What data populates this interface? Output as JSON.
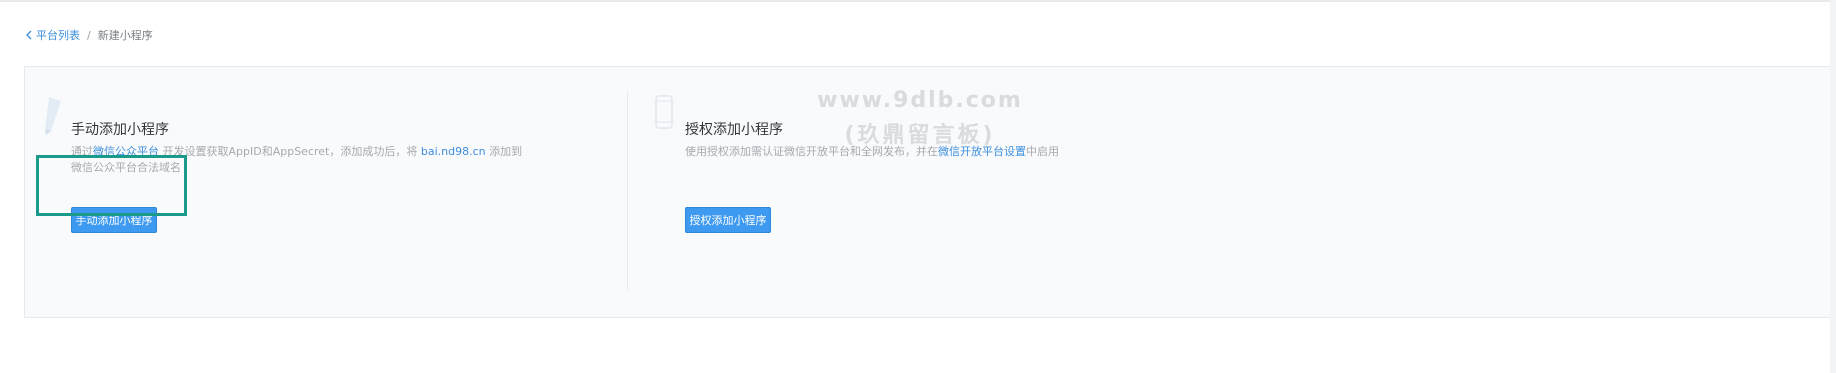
{
  "breadcrumb": {
    "back_label": "平台列表",
    "separator": "/",
    "current": "新建小程序"
  },
  "manual_card": {
    "title": "手动添加小程序",
    "desc_prefix": "通过",
    "desc_link": "微信公众平台",
    "desc_middle": "开发设置获取AppID和AppSecret，添加成功后，将",
    "desc_domain": "bai.nd98.cn",
    "desc_suffix": "添加到微信公众平台合法域名",
    "button_label": "手动添加小程序",
    "icon": "pencil-icon"
  },
  "auth_card": {
    "title": "授权添加小程序",
    "desc_prefix": "使用授权添加需认证微信开放平台和全网发布，并在",
    "desc_link": "微信开放平台设置",
    "desc_suffix": "中启用",
    "button_label": "授权添加小程序",
    "icon": "mobile-phone-icon"
  },
  "watermark": {
    "line1": "www.9dlb.com",
    "line2": "(玖鼎留言板)"
  },
  "colors": {
    "link": "#3d8fde",
    "primary_button": "#3d9af0",
    "highlight_border": "#1a9a8a"
  }
}
